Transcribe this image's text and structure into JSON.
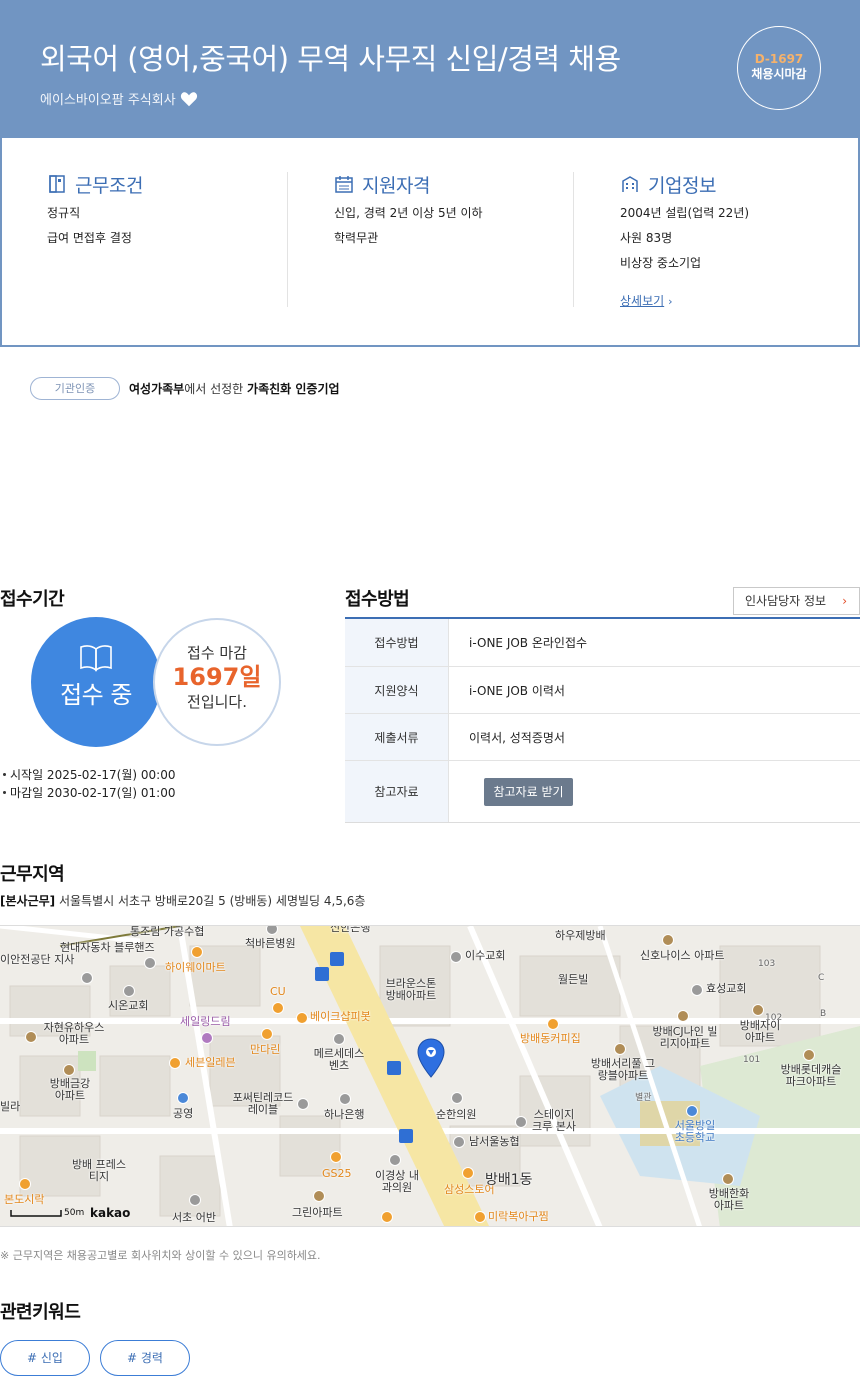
{
  "header": {
    "title": "외국어 (영어,중국어) 무역 사무직 신입/경력 채용",
    "company": "에이스바이오팜 주식회사",
    "dday": "D-1697",
    "dday_label": "채용시마감"
  },
  "summary": {
    "work_conditions": {
      "title": "근무조건",
      "lines": [
        "정규직",
        "급여 면접후 결정"
      ]
    },
    "qualifications": {
      "title": "지원자격",
      "lines": [
        "신입, 경력 2년 이상 5년 이하",
        "학력무관"
      ]
    },
    "company_info": {
      "title": "기업정보",
      "lines": [
        "2004년 설립(업력 22년)",
        "사원 83명",
        "비상장 중소기업"
      ],
      "detail_link": "상세보기"
    }
  },
  "certification": {
    "badge": "기관인증",
    "org": "여성가족부",
    "text_mid": "에서 선정한 ",
    "cert_name": "가족친화 인증기업"
  },
  "receipt_period": {
    "title": "접수기간",
    "status": "접수 중",
    "deadline_label": "접수 마감",
    "days": "1697일",
    "days_suffix": "전입니다.",
    "start": "시작일 2025-02-17(월) 00:00",
    "end": "마감일 2030-02-17(일) 01:00"
  },
  "receipt_method": {
    "title": "접수방법",
    "hr_button": "인사담당자 정보",
    "rows": [
      {
        "label": "접수방법",
        "value": "i-ONE JOB 온라인접수"
      },
      {
        "label": "지원양식",
        "value": "i-ONE JOB 이력서"
      },
      {
        "label": "제출서류",
        "value": "이력서, 성적증명서"
      },
      {
        "label": "참고자료",
        "button": "참고자료 받기"
      }
    ]
  },
  "work_area": {
    "title": "근무지역",
    "office": "[본사근무]",
    "address": "서울특별시 서초구 방배로20길 5 (방배동) 세명빌딩 4,5,6층",
    "note": "※ 근무지역은 채용공고별로 회사위치와 상이할 수 있으니 유의하세요.",
    "map": {
      "scale": "50m",
      "provider": "kakao",
      "labels": [
        "통조림 가공수협",
        "현대자동차 블루핸즈",
        "이안전공단 지사",
        "척바른병원",
        "하이웨이마트",
        "신한은행",
        "이수교회",
        "하우제방배",
        "신호나이스 아파트",
        "효성교회",
        "103",
        "102",
        "101",
        "C",
        "B",
        "시온교회",
        "세일링드림",
        "CU",
        "베이크샵피봇",
        "브라운스톤 방배아파트",
        "월든빌",
        "자현유하우스 아파트",
        "만다린",
        "메르세데스 벤츠",
        "방배동커피집",
        "방배CJ나인 빌리지아파트",
        "방배자이 아파트",
        "세븐일레븐",
        "방배서리풀 그랑블아파트",
        "방배롯데캐슬 파크아파트",
        "방배금강 아파트",
        "빌라",
        "공영",
        "포써틴레코드 레이블",
        "하나은행",
        "순한의원",
        "스테이지 크루 본사",
        "별관",
        "서울방일 초등학교",
        "남서울농협",
        "방배 프레스티지",
        "GS25",
        "이경상 내과의원",
        "삼성스토어",
        "방배1동",
        "방배한화 아파트",
        "본도시락",
        "그린아파트",
        "서초 어반",
        "미락복아구찜"
      ]
    }
  },
  "keywords": {
    "title": "관련키워드",
    "items": [
      "# 신입",
      "# 경력"
    ]
  }
}
